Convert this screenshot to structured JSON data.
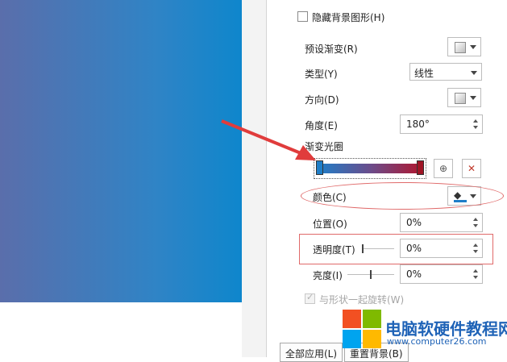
{
  "panel": {
    "hide_bg_graphics_label": "隐藏背景图形(H)",
    "preset_gradient_label": "预设渐变(R)",
    "type_label": "类型(Y)",
    "type_value": "线性",
    "direction_label": "方向(D)",
    "angle_label": "角度(E)",
    "angle_value": "180°",
    "gradient_stops_label": "渐变光圈",
    "color_label": "颜色(C)",
    "position_label": "位置(O)",
    "position_value": "0%",
    "transparency_label": "透明度(T)",
    "transparency_value": "0%",
    "brightness_label": "亮度(I)",
    "brightness_value": "0%",
    "rotate_with_shape_label": "与形状一起旋转(W)",
    "apply_all_label": "全部应用(L)",
    "reset_bg_label": "重置背景(B)"
  },
  "colors": {
    "gradient_start": "#1e7ec8",
    "gradient_end": "#b0162e",
    "highlight": "#e06a6a",
    "arrow": "#e03c3c"
  },
  "watermark": {
    "title": "电脑软硬件教程网",
    "url": "www.computer26.com"
  }
}
